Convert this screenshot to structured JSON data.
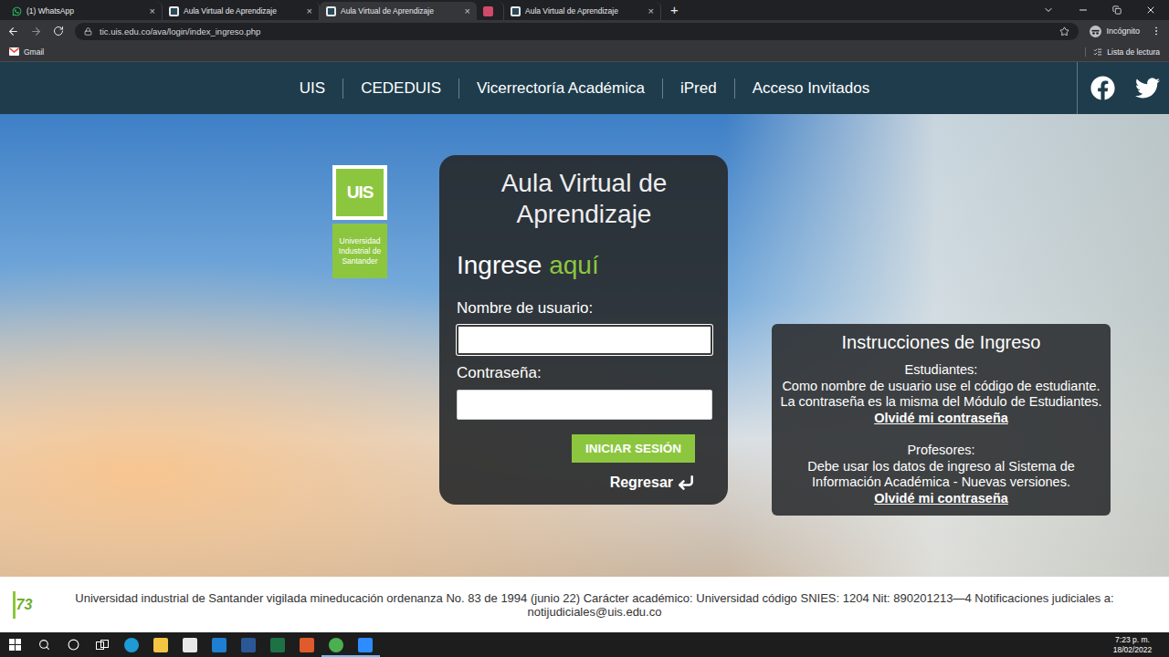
{
  "browser": {
    "tabs": [
      {
        "label": "(1) WhatsApp",
        "kind": "whatsapp",
        "selected": false
      },
      {
        "label": "Aula Virtual de Aprendizaje",
        "kind": "ava",
        "selected": false
      },
      {
        "label": "Aula Virtual de Aprendizaje",
        "kind": "ava",
        "selected": true
      },
      {
        "kind": "media",
        "selected": false
      },
      {
        "label": "Aula Virtual de Aprendizaje",
        "kind": "ava",
        "selected": false
      }
    ],
    "tab_close": "×",
    "new_tab": "+",
    "url": "tic.uis.edu.co/ava/login/index_ingreso.php",
    "incognito": "Incógnito",
    "bookmarks": [
      {
        "label": "Gmail"
      }
    ],
    "reading_list": "Lista de lectura"
  },
  "site_nav": {
    "items": [
      "UIS",
      "CEDEDUIS",
      "Vicerrectoría Académica",
      "iPred",
      "Acceso Invitados"
    ]
  },
  "logo": {
    "mark": "UIS",
    "name": "Universidad Industrial de Santander"
  },
  "login": {
    "title": "Aula Virtual de Aprendizaje",
    "heading": "Ingrese",
    "heading_accent": "aquí",
    "fields": [
      {
        "label": "Nombre de usuario:",
        "kind": "text",
        "focused": true
      },
      {
        "label": "Contraseña:",
        "kind": "password",
        "focused": false
      }
    ],
    "submit": "INICIAR SESIÓN",
    "back": "Regresar"
  },
  "instructions": {
    "title": "Instrucciones de Ingreso",
    "sections": [
      {
        "heading": "Estudiantes:",
        "text": "Como nombre de usuario use el código de estudiante. La contraseña es la misma del Módulo de Estudiantes.",
        "link": "Olvidé mi contraseña"
      },
      {
        "heading": "Profesores:",
        "text": "Debe usar los datos de ingreso al Sistema de Información Académica - Nuevas versiones.",
        "link": "Olvidé mi contraseña"
      }
    ]
  },
  "footer": {
    "badge": "73",
    "text": "Universidad industrial de Santander vigilada mineducación ordenanza No. 83 de 1994 (junio 22) Carácter académico: Universidad código SNIES: 1204 Nit: 890201213—4 Notificaciones judiciales a: notijudiciales@uis.edu.co"
  },
  "taskbar": {
    "apps": [
      {
        "open": false
      },
      {
        "open": false
      },
      {
        "open": false
      },
      {
        "open": false
      },
      {
        "open": false
      },
      {
        "open": false
      },
      {
        "open": false
      },
      {
        "open": true
      },
      {
        "open": true
      }
    ],
    "time": "7:23 p. m.",
    "date": "18/02/2022"
  }
}
